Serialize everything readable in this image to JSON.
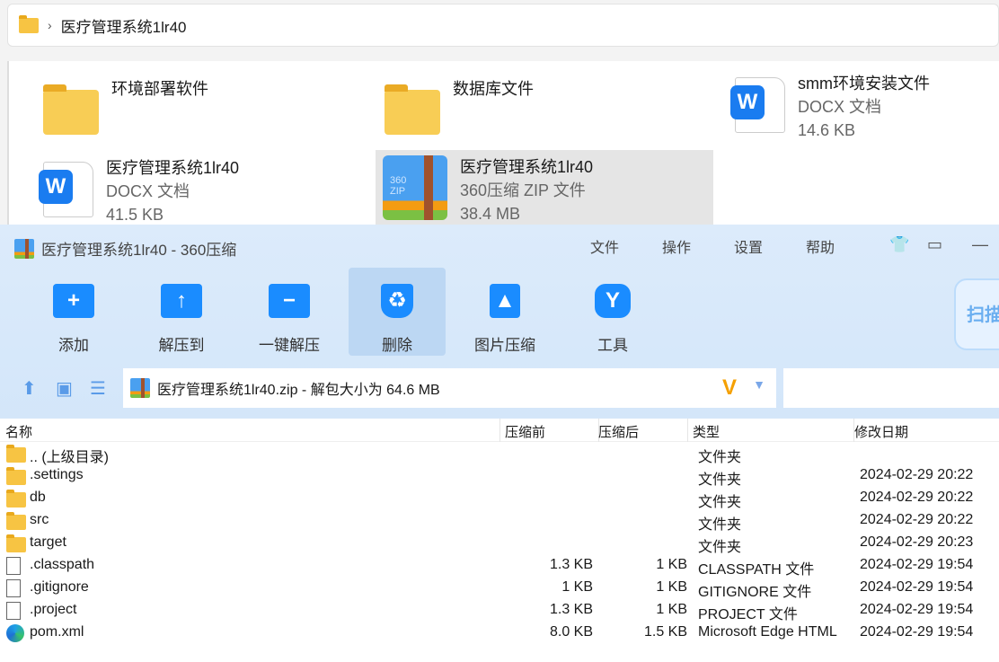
{
  "explorer": {
    "breadcrumb": "医疗管理系统1lr40",
    "tiles": [
      {
        "name": "环境部署软件",
        "type": "",
        "size": ""
      },
      {
        "name": "数据库文件",
        "type": "",
        "size": ""
      },
      {
        "name": "smm环境安装文件",
        "type": "DOCX 文档",
        "size": "14.6 KB"
      },
      {
        "name": "医疗管理系统1lr40",
        "type": "DOCX 文档",
        "size": "41.5 KB"
      },
      {
        "name": "医疗管理系统1lr40",
        "type": "360压缩 ZIP 文件",
        "size": "38.4 MB"
      }
    ]
  },
  "app": {
    "title": "医疗管理系统1lr40 - 360压缩",
    "menu": [
      "文件",
      "操作",
      "设置",
      "帮助"
    ],
    "toolbar": [
      "添加",
      "解压到",
      "一键解压",
      "删除",
      "图片压缩",
      "工具"
    ],
    "scan": "扫描",
    "path": "医疗管理系统1lr40.zip - 解包大小为 64.6 MB",
    "columns": [
      "名称",
      "压缩前",
      "压缩后",
      "类型",
      "修改日期"
    ],
    "rows": [
      {
        "name": ".. (上级目录)",
        "before": "",
        "after": "",
        "type": "文件夹",
        "date": ""
      },
      {
        "name": ".settings",
        "before": "",
        "after": "",
        "type": "文件夹",
        "date": "2024-02-29 20:22"
      },
      {
        "name": "db",
        "before": "",
        "after": "",
        "type": "文件夹",
        "date": "2024-02-29 20:22"
      },
      {
        "name": "src",
        "before": "",
        "after": "",
        "type": "文件夹",
        "date": "2024-02-29 20:22"
      },
      {
        "name": "target",
        "before": "",
        "after": "",
        "type": "文件夹",
        "date": "2024-02-29 20:23"
      },
      {
        "name": ".classpath",
        "before": "1.3 KB",
        "after": "1 KB",
        "type": "CLASSPATH 文件",
        "date": "2024-02-29 19:54"
      },
      {
        "name": ".gitignore",
        "before": "1 KB",
        "after": "1 KB",
        "type": "GITIGNORE 文件",
        "date": "2024-02-29 19:54"
      },
      {
        "name": ".project",
        "before": "1.3 KB",
        "after": "1 KB",
        "type": "PROJECT 文件",
        "date": "2024-02-29 19:54"
      },
      {
        "name": "pom.xml",
        "before": "8.0 KB",
        "after": "1.5 KB",
        "type": "Microsoft Edge HTML",
        "date": "2024-02-29 19:54"
      }
    ]
  }
}
